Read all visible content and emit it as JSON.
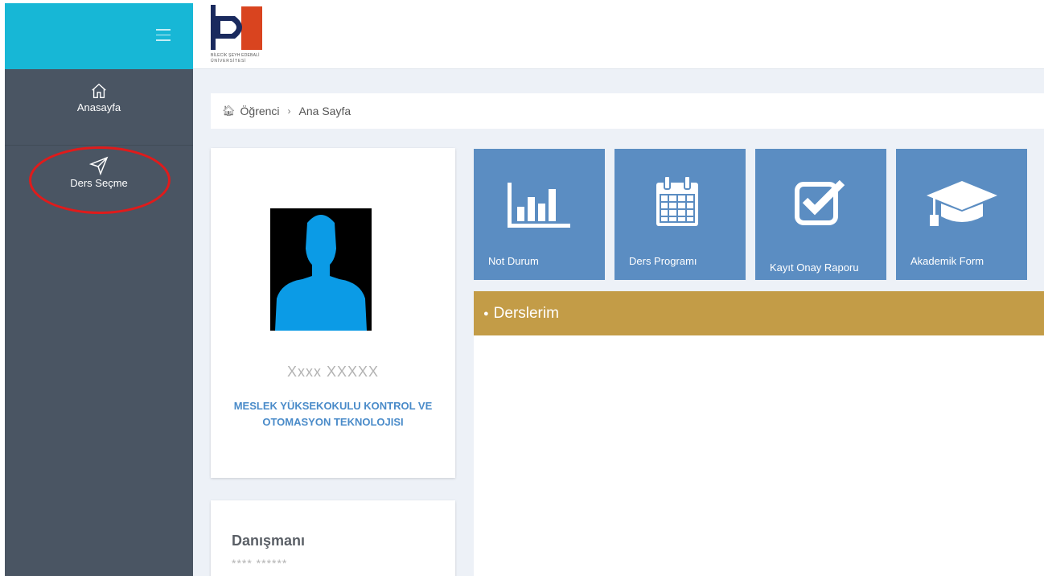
{
  "sidebar": {
    "items": [
      {
        "label": "Anasayfa",
        "icon": "home-icon"
      },
      {
        "label": "Ders Seçme",
        "icon": "send-icon"
      }
    ]
  },
  "header": {
    "logo_line1": "BİLECİK ŞEYH EDEBALİ",
    "logo_line2": "ÜNİVERSİTESİ"
  },
  "breadcrumb": {
    "root": "Öğrenci",
    "current": "Ana Sayfa"
  },
  "profile": {
    "name": "Xxxx  XXXXX",
    "department": "MESLEK YÜKSEKOKULU KONTROL VE OTOMASYON TEKNOLOJISI"
  },
  "advisor": {
    "title": "Danışmanı",
    "name": "**** ******"
  },
  "tiles": [
    {
      "label": "Not Durum",
      "icon": "bar-chart-icon"
    },
    {
      "label": "Ders Programı",
      "icon": "calendar-icon"
    },
    {
      "label": "Kayıt Onay Raporu",
      "icon": "checkbox-icon"
    },
    {
      "label": "Akademik Form",
      "icon": "graduation-cap-icon"
    }
  ],
  "panel": {
    "title": "Derslerim"
  },
  "colors": {
    "topbar": "#17b7d6",
    "sidebar": "#4a5563",
    "tile": "#5b8dc2",
    "panel_header": "#c39c47",
    "department_text": "#4a8bc9",
    "highlight_circle": "#e01b1b"
  }
}
